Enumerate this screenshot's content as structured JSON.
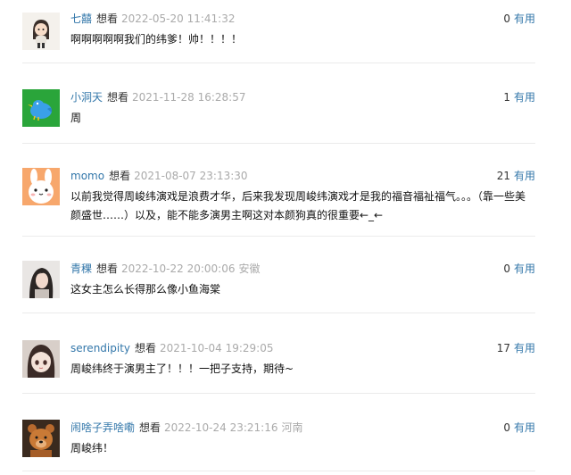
{
  "comments": [
    {
      "user": "七囍",
      "action": "想看",
      "time": "2022-05-20 11:41:32",
      "location": "",
      "votes": "0",
      "vote_label": "有用",
      "content": "啊啊啊啊啊我们的纬爹！帅！！！！",
      "avatar_icon": "girl-cartoon-avatar"
    },
    {
      "user": "小洞天",
      "action": "想看",
      "time": "2021-11-28 16:28:57",
      "location": "",
      "votes": "1",
      "vote_label": "有用",
      "content": "周",
      "avatar_icon": "blue-bird-avatar"
    },
    {
      "user": "momo",
      "action": "想看",
      "time": "2021-08-07 23:13:30",
      "location": "",
      "votes": "21",
      "vote_label": "有用",
      "content": "以前我觉得周峻纬演戏是浪费才华，后来我发现周峻纬演戏才是我的福音福祉福气。。。（靠一些美颜盛世……）以及，能不能多演男主啊这对本颜狗真的很重要←_←",
      "avatar_icon": "bunny-avatar"
    },
    {
      "user": "青稞",
      "action": "想看",
      "time": "2022-10-22 20:00:06",
      "location": "安徽",
      "votes": "0",
      "vote_label": "有用",
      "content": "这女主怎么长得那么像小鱼海棠",
      "avatar_icon": "portrait-avatar"
    },
    {
      "user": "serendipity",
      "action": "想看",
      "time": "2021-10-04 19:29:05",
      "location": "",
      "votes": "17",
      "vote_label": "有用",
      "content": "周峻纬终于演男主了！！！一把子支持，期待~",
      "avatar_icon": "anime-girl-avatar"
    },
    {
      "user": "闹啥子弄啥嘞",
      "action": "想看",
      "time": "2022-10-24 23:21:16",
      "location": "河南",
      "votes": "0",
      "vote_label": "有用",
      "content": "周峻纬！",
      "avatar_icon": "bear-avatar"
    }
  ]
}
